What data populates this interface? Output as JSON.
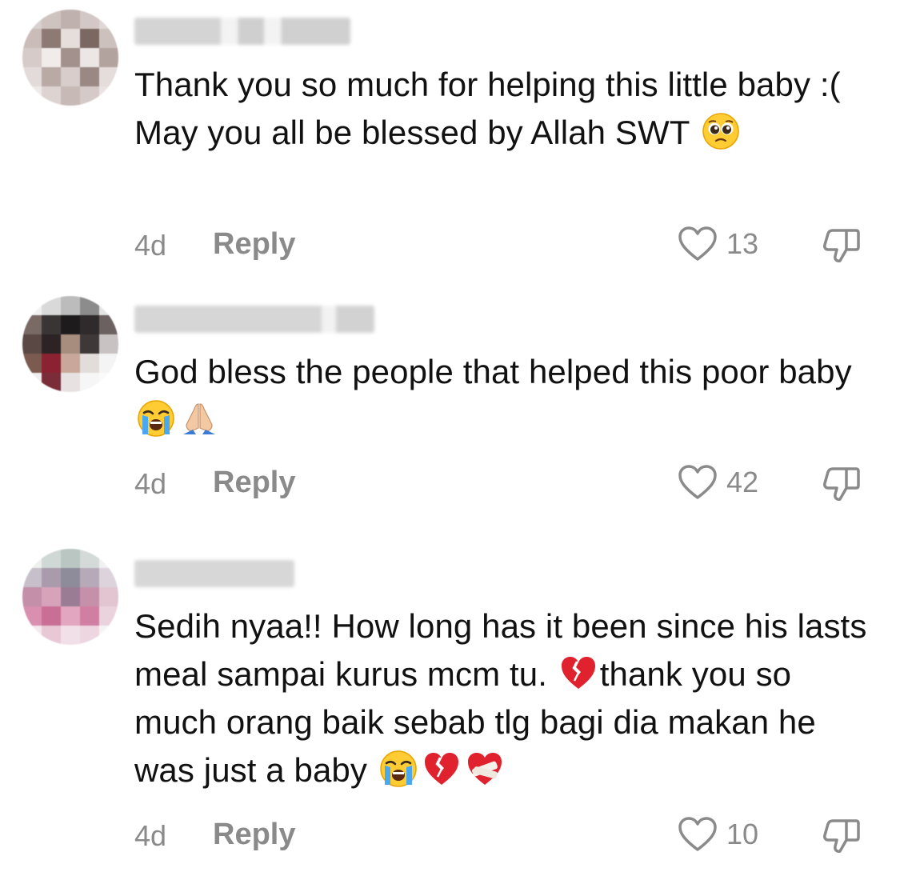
{
  "comments": [
    {
      "text_parts": [
        "Thank you so much for helping this little baby :( May you all be blessed by Allah SWT"
      ],
      "emojis": [
        "pleading-face"
      ],
      "time": "4d",
      "reply_label": "Reply",
      "likes": "13"
    },
    {
      "text_parts": [
        "God bless the people that helped this poor baby"
      ],
      "emojis": [
        "loudly-crying-face",
        "folded-hands"
      ],
      "time": "4d",
      "reply_label": "Reply",
      "likes": "42"
    },
    {
      "text_parts": [
        "Sedih nyaa!! How long has it been since his lasts meal sampai kurus mcm tu.",
        "thank you so much orang baik sebab tlg bagi dia makan he was just a baby"
      ],
      "emojis": [
        "broken-heart",
        "loudly-crying-face",
        "broken-heart",
        "mending-heart"
      ],
      "time": "4d",
      "reply_label": "Reply",
      "likes": "10"
    }
  ],
  "colors": {
    "text": "#111111",
    "muted": "#8a8a8a",
    "background": "#ffffff"
  }
}
